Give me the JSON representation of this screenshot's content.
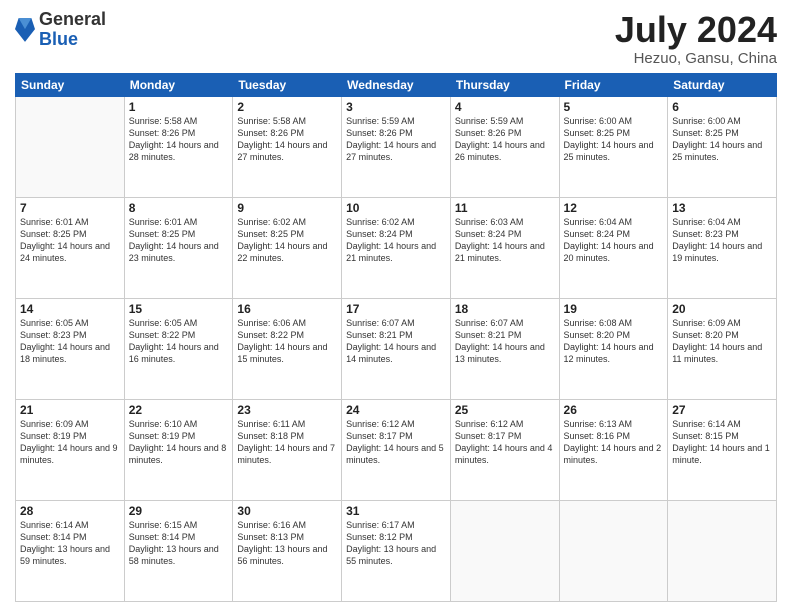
{
  "logo": {
    "general": "General",
    "blue": "Blue"
  },
  "title": {
    "month_year": "July 2024",
    "location": "Hezuo, Gansu, China"
  },
  "weekdays": [
    "Sunday",
    "Monday",
    "Tuesday",
    "Wednesday",
    "Thursday",
    "Friday",
    "Saturday"
  ],
  "weeks": [
    [
      {
        "day": "",
        "empty": true
      },
      {
        "day": "1",
        "sunrise": "5:58 AM",
        "sunset": "8:26 PM",
        "daylight": "14 hours and 28 minutes."
      },
      {
        "day": "2",
        "sunrise": "5:58 AM",
        "sunset": "8:26 PM",
        "daylight": "14 hours and 27 minutes."
      },
      {
        "day": "3",
        "sunrise": "5:59 AM",
        "sunset": "8:26 PM",
        "daylight": "14 hours and 27 minutes."
      },
      {
        "day": "4",
        "sunrise": "5:59 AM",
        "sunset": "8:26 PM",
        "daylight": "14 hours and 26 minutes."
      },
      {
        "day": "5",
        "sunrise": "6:00 AM",
        "sunset": "8:25 PM",
        "daylight": "14 hours and 25 minutes."
      },
      {
        "day": "6",
        "sunrise": "6:00 AM",
        "sunset": "8:25 PM",
        "daylight": "14 hours and 25 minutes."
      }
    ],
    [
      {
        "day": "7",
        "sunrise": "6:01 AM",
        "sunset": "8:25 PM",
        "daylight": "14 hours and 24 minutes."
      },
      {
        "day": "8",
        "sunrise": "6:01 AM",
        "sunset": "8:25 PM",
        "daylight": "14 hours and 23 minutes."
      },
      {
        "day": "9",
        "sunrise": "6:02 AM",
        "sunset": "8:25 PM",
        "daylight": "14 hours and 22 minutes."
      },
      {
        "day": "10",
        "sunrise": "6:02 AM",
        "sunset": "8:24 PM",
        "daylight": "14 hours and 21 minutes."
      },
      {
        "day": "11",
        "sunrise": "6:03 AM",
        "sunset": "8:24 PM",
        "daylight": "14 hours and 21 minutes."
      },
      {
        "day": "12",
        "sunrise": "6:04 AM",
        "sunset": "8:24 PM",
        "daylight": "14 hours and 20 minutes."
      },
      {
        "day": "13",
        "sunrise": "6:04 AM",
        "sunset": "8:23 PM",
        "daylight": "14 hours and 19 minutes."
      }
    ],
    [
      {
        "day": "14",
        "sunrise": "6:05 AM",
        "sunset": "8:23 PM",
        "daylight": "14 hours and 18 minutes."
      },
      {
        "day": "15",
        "sunrise": "6:05 AM",
        "sunset": "8:22 PM",
        "daylight": "14 hours and 16 minutes."
      },
      {
        "day": "16",
        "sunrise": "6:06 AM",
        "sunset": "8:22 PM",
        "daylight": "14 hours and 15 minutes."
      },
      {
        "day": "17",
        "sunrise": "6:07 AM",
        "sunset": "8:21 PM",
        "daylight": "14 hours and 14 minutes."
      },
      {
        "day": "18",
        "sunrise": "6:07 AM",
        "sunset": "8:21 PM",
        "daylight": "14 hours and 13 minutes."
      },
      {
        "day": "19",
        "sunrise": "6:08 AM",
        "sunset": "8:20 PM",
        "daylight": "14 hours and 12 minutes."
      },
      {
        "day": "20",
        "sunrise": "6:09 AM",
        "sunset": "8:20 PM",
        "daylight": "14 hours and 11 minutes."
      }
    ],
    [
      {
        "day": "21",
        "sunrise": "6:09 AM",
        "sunset": "8:19 PM",
        "daylight": "14 hours and 9 minutes."
      },
      {
        "day": "22",
        "sunrise": "6:10 AM",
        "sunset": "8:19 PM",
        "daylight": "14 hours and 8 minutes."
      },
      {
        "day": "23",
        "sunrise": "6:11 AM",
        "sunset": "8:18 PM",
        "daylight": "14 hours and 7 minutes."
      },
      {
        "day": "24",
        "sunrise": "6:12 AM",
        "sunset": "8:17 PM",
        "daylight": "14 hours and 5 minutes."
      },
      {
        "day": "25",
        "sunrise": "6:12 AM",
        "sunset": "8:17 PM",
        "daylight": "14 hours and 4 minutes."
      },
      {
        "day": "26",
        "sunrise": "6:13 AM",
        "sunset": "8:16 PM",
        "daylight": "14 hours and 2 minutes."
      },
      {
        "day": "27",
        "sunrise": "6:14 AM",
        "sunset": "8:15 PM",
        "daylight": "14 hours and 1 minute."
      }
    ],
    [
      {
        "day": "28",
        "sunrise": "6:14 AM",
        "sunset": "8:14 PM",
        "daylight": "13 hours and 59 minutes."
      },
      {
        "day": "29",
        "sunrise": "6:15 AM",
        "sunset": "8:14 PM",
        "daylight": "13 hours and 58 minutes."
      },
      {
        "day": "30",
        "sunrise": "6:16 AM",
        "sunset": "8:13 PM",
        "daylight": "13 hours and 56 minutes."
      },
      {
        "day": "31",
        "sunrise": "6:17 AM",
        "sunset": "8:12 PM",
        "daylight": "13 hours and 55 minutes."
      },
      {
        "day": "",
        "empty": true
      },
      {
        "day": "",
        "empty": true
      },
      {
        "day": "",
        "empty": true
      }
    ]
  ]
}
